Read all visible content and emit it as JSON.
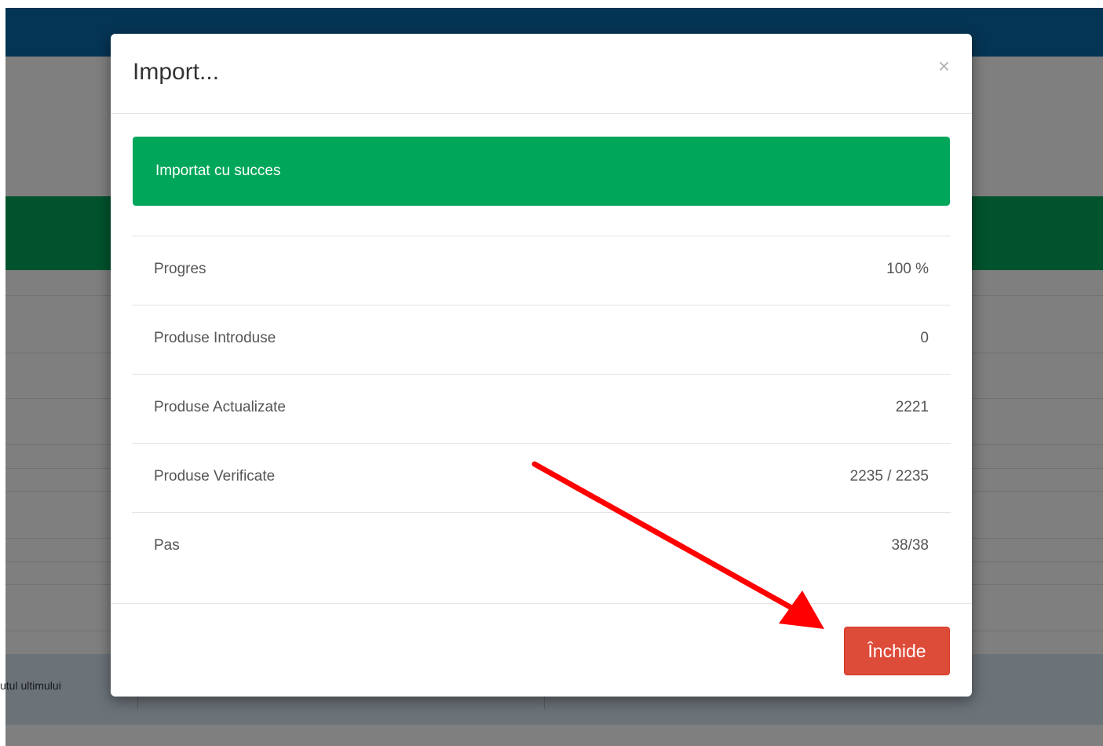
{
  "background": {
    "footer_text": "utul ultimului"
  },
  "modal": {
    "title": "Import...",
    "close_icon": "×",
    "alert": "Importat cu succes",
    "stats": [
      {
        "label": "Progres",
        "value": "100 %"
      },
      {
        "label": "Produse Introduse",
        "value": "0"
      },
      {
        "label": "Produse Actualizate",
        "value": "2221"
      },
      {
        "label": "Produse Verificate",
        "value": "2235 / 2235"
      },
      {
        "label": "Pas",
        "value": "38/38"
      }
    ],
    "close_button": "Închide"
  },
  "colors": {
    "success": "#00a65a",
    "danger": "#dd4b39",
    "topbar": "#0a6aa8",
    "annotation_arrow": "#ff0000"
  }
}
